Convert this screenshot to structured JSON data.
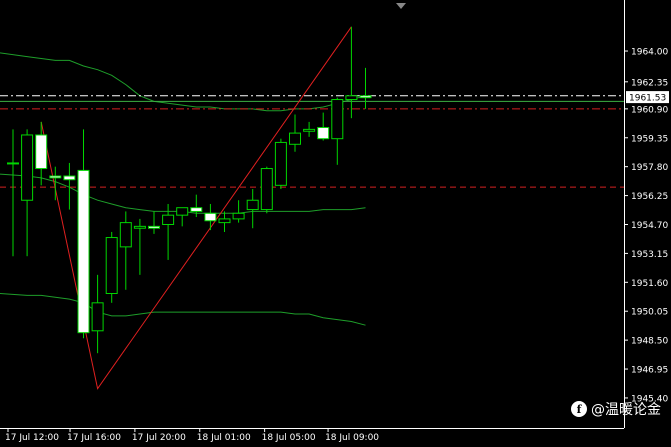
{
  "chart_data": {
    "type": "candlestick",
    "symbol_period": "",
    "y_range": [
      1944.7,
      1966.2
    ],
    "y_ticks": [
      "1964.00",
      "1962.35",
      "1960.90",
      "1959.35",
      "1957.80",
      "1956.25",
      "1954.70",
      "1953.15",
      "1951.60",
      "1950.05",
      "1948.50",
      "1946.95",
      "1945.40"
    ],
    "x_ticks": [
      "17 Jul 12:00",
      "17 Jul 16:00",
      "17 Jul 20:00",
      "18 Jul 01:00",
      "18 Jul 05:00",
      "18 Jul 09:00"
    ],
    "current_price": "1961.53",
    "candles": [
      {
        "o": 1958.0,
        "h": 1959.8,
        "l": 1953.0,
        "c": 1958.0
      },
      {
        "o": 1956.0,
        "h": 1959.8,
        "l": 1953.0,
        "c": 1959.5
      },
      {
        "o": 1959.5,
        "h": 1960.2,
        "l": 1956.8,
        "c": 1957.7
      },
      {
        "o": 1957.3,
        "h": 1957.8,
        "l": 1956.0,
        "c": 1957.2
      },
      {
        "o": 1957.3,
        "h": 1958.0,
        "l": 1955.5,
        "c": 1957.1
      },
      {
        "o": 1957.6,
        "h": 1959.8,
        "l": 1948.6,
        "c": 1948.9
      },
      {
        "o": 1949.0,
        "h": 1952.0,
        "l": 1947.8,
        "c": 1950.5
      },
      {
        "o": 1951.0,
        "h": 1954.3,
        "l": 1950.5,
        "c": 1954.0
      },
      {
        "o": 1953.5,
        "h": 1955.4,
        "l": 1951.2,
        "c": 1954.8
      },
      {
        "o": 1954.5,
        "h": 1955.0,
        "l": 1952.0,
        "c": 1954.6
      },
      {
        "o": 1954.6,
        "h": 1955.4,
        "l": 1954.2,
        "c": 1954.5
      },
      {
        "o": 1954.7,
        "h": 1955.8,
        "l": 1952.8,
        "c": 1955.2
      },
      {
        "o": 1955.2,
        "h": 1955.6,
        "l": 1954.6,
        "c": 1955.6
      },
      {
        "o": 1955.6,
        "h": 1956.3,
        "l": 1955.1,
        "c": 1955.4
      },
      {
        "o": 1955.3,
        "h": 1955.8,
        "l": 1954.4,
        "c": 1954.9
      },
      {
        "o": 1954.8,
        "h": 1955.4,
        "l": 1954.3,
        "c": 1955.0
      },
      {
        "o": 1955.0,
        "h": 1956.0,
        "l": 1954.8,
        "c": 1955.3
      },
      {
        "o": 1955.5,
        "h": 1956.6,
        "l": 1954.5,
        "c": 1956.0
      },
      {
        "o": 1955.5,
        "h": 1957.8,
        "l": 1955.3,
        "c": 1957.7
      },
      {
        "o": 1956.8,
        "h": 1959.3,
        "l": 1956.6,
        "c": 1959.1
      },
      {
        "o": 1959.0,
        "h": 1960.6,
        "l": 1958.6,
        "c": 1959.6
      },
      {
        "o": 1959.7,
        "h": 1960.2,
        "l": 1959.4,
        "c": 1959.8
      },
      {
        "o": 1959.9,
        "h": 1960.7,
        "l": 1959.2,
        "c": 1959.3
      },
      {
        "o": 1959.3,
        "h": 1961.5,
        "l": 1957.9,
        "c": 1961.4
      },
      {
        "o": 1961.4,
        "h": 1965.3,
        "l": 1960.4,
        "c": 1961.6
      },
      {
        "o": 1961.6,
        "h": 1963.1,
        "l": 1960.9,
        "c": 1961.5
      }
    ],
    "upper_band": [
      1963.9,
      1963.7,
      1963.6,
      1963.5,
      1963.5,
      1963.2,
      1963.0,
      1962.7,
      1962.2,
      1961.6,
      1961.3,
      1961.2,
      1961.1,
      1961.0,
      1961.0,
      1960.9,
      1960.9,
      1960.9,
      1960.8,
      1960.8,
      1960.9,
      1960.9,
      1961.0,
      1961.2,
      1961.4,
      1961.6
    ],
    "middle_band": [
      1957.4,
      1957.3,
      1957.2,
      1957.0,
      1956.7,
      1956.3,
      1956.0,
      1955.8,
      1955.6,
      1955.5,
      1955.4,
      1955.4,
      1955.4,
      1955.3,
      1955.3,
      1955.3,
      1955.3,
      1955.4,
      1955.4,
      1955.4,
      1955.4,
      1955.4,
      1955.5,
      1955.5,
      1955.5,
      1955.6
    ],
    "lower_band": [
      1951.0,
      1950.9,
      1950.9,
      1950.8,
      1950.7,
      1950.5,
      1950.0,
      1949.8,
      1949.8,
      1949.9,
      1950.0,
      1950.0,
      1950.0,
      1950.0,
      1950.0,
      1950.0,
      1950.0,
      1950.0,
      1950.0,
      1950.0,
      1949.9,
      1949.9,
      1949.7,
      1949.6,
      1949.5,
      1949.3
    ],
    "zigzag": [
      {
        "index": 2,
        "price": 1960.2
      },
      {
        "index": 6,
        "price": 1945.9
      },
      {
        "index": 24,
        "price": 1965.3
      }
    ],
    "horizontal_lines": [
      {
        "price": 1961.6,
        "color": "#ffffff",
        "style": "dash-dot"
      },
      {
        "price": 1961.3,
        "color": "#3cb043",
        "style": "solid"
      },
      {
        "price": 1960.9,
        "color": "#d42020",
        "style": "dash-dot"
      },
      {
        "price": 1956.7,
        "color": "#d42020",
        "style": "dashed"
      }
    ],
    "colors": {
      "background": "#000000",
      "bull_body": "#000000",
      "bear_body": "#ffffff",
      "candle_outline": "#00d600",
      "bands": "#1e9e2a",
      "zigzag": "#e02020",
      "axis_text": "#ffffff"
    }
  },
  "watermark": {
    "text": "@温暖论金",
    "icon": "f"
  }
}
